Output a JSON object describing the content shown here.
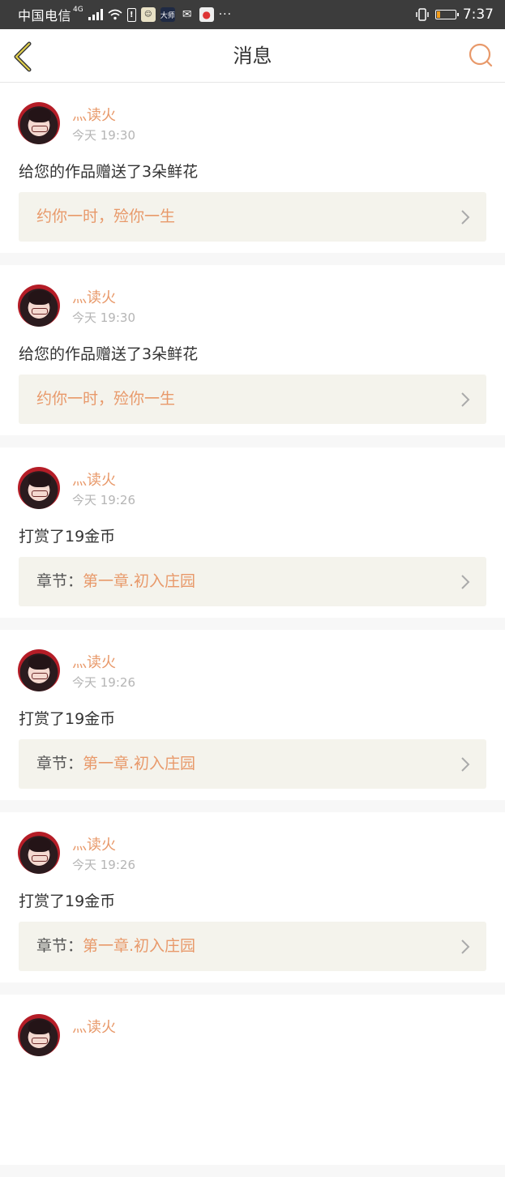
{
  "status_bar": {
    "carrier": "中国电信",
    "network": "4G",
    "mini_app_label": "大师",
    "more": "···",
    "time": "7:37",
    "battery_level": 0.2
  },
  "nav": {
    "title": "消息"
  },
  "messages": [
    {
      "user": "灬读火",
      "time": "今天 19:30",
      "content": "给您的作品赠送了3朵鲜花",
      "link_prefix": "",
      "link_text": "约你一时，殓你一生"
    },
    {
      "user": "灬读火",
      "time": "今天 19:30",
      "content": "给您的作品赠送了3朵鲜花",
      "link_prefix": "",
      "link_text": "约你一时，殓你一生"
    },
    {
      "user": "灬读火",
      "time": "今天 19:26",
      "content": "打赏了19金币",
      "link_prefix": "章节：",
      "link_text": "第一章.初入庄园"
    },
    {
      "user": "灬读火",
      "time": "今天 19:26",
      "content": "打赏了19金币",
      "link_prefix": "章节：",
      "link_text": "第一章.初入庄园"
    },
    {
      "user": "灬读火",
      "time": "今天 19:26",
      "content": "打赏了19金币",
      "link_prefix": "章节：",
      "link_text": "第一章.初入庄园"
    },
    {
      "user": "灬读火",
      "time": "",
      "content": "",
      "link_prefix": "",
      "link_text": ""
    }
  ],
  "colors": {
    "accent": "#e8996a",
    "link_bg": "#f4f3ec",
    "status_bar": "#3c3c3c",
    "back_icon": "#d9b800"
  }
}
